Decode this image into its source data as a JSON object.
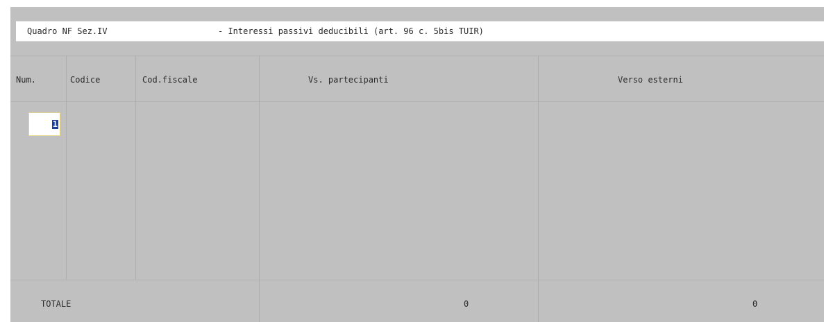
{
  "header": {
    "section_label": "Quadro NF Sez.IV",
    "section_title": "- Interessi passivi deducibili (art. 96 c. 5bis TUIR)"
  },
  "table": {
    "columns": [
      "Num.",
      "Codice",
      "Cod.fiscale",
      "Vs. partecipanti",
      "Verso esterni"
    ],
    "rows": [
      {
        "num": "1",
        "codice": "",
        "cod_fiscale": "",
        "vs_partecipanti": "",
        "verso_esterni": ""
      }
    ]
  },
  "totals": {
    "label": "TOTALE",
    "vs_partecipanti": "0",
    "verso_esterni": "0"
  }
}
